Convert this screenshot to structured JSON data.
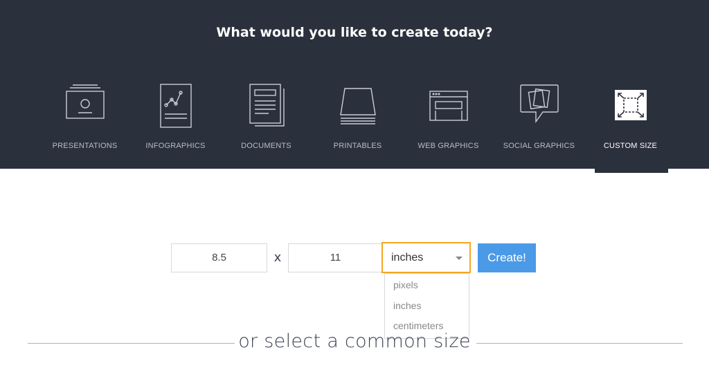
{
  "header": {
    "title": "What would you like to create today?",
    "background": "#2b303d"
  },
  "categories": [
    {
      "label": "PRESENTATIONS",
      "icon": "presentation-icon",
      "active": false
    },
    {
      "label": "INFOGRAPHICS",
      "icon": "infographic-icon",
      "active": false
    },
    {
      "label": "DOCUMENTS",
      "icon": "document-icon",
      "active": false
    },
    {
      "label": "PRINTABLES",
      "icon": "printable-icon",
      "active": false
    },
    {
      "label": "WEB GRAPHICS",
      "icon": "web-graphic-icon",
      "active": false
    },
    {
      "label": "SOCIAL GRAPHICS",
      "icon": "social-graphic-icon",
      "active": false
    },
    {
      "label": "CUSTOM SIZE",
      "icon": "custom-size-icon",
      "active": true
    }
  ],
  "custom_size": {
    "width": "8.5",
    "times": "x",
    "height": "11",
    "unit": "inches",
    "unit_options": [
      "pixels",
      "inches",
      "centimeters"
    ],
    "create_label": "Create!"
  },
  "common": {
    "label": "or select a common size"
  },
  "colors": {
    "accent": "#4a9ae8",
    "focus": "#f5a623"
  }
}
